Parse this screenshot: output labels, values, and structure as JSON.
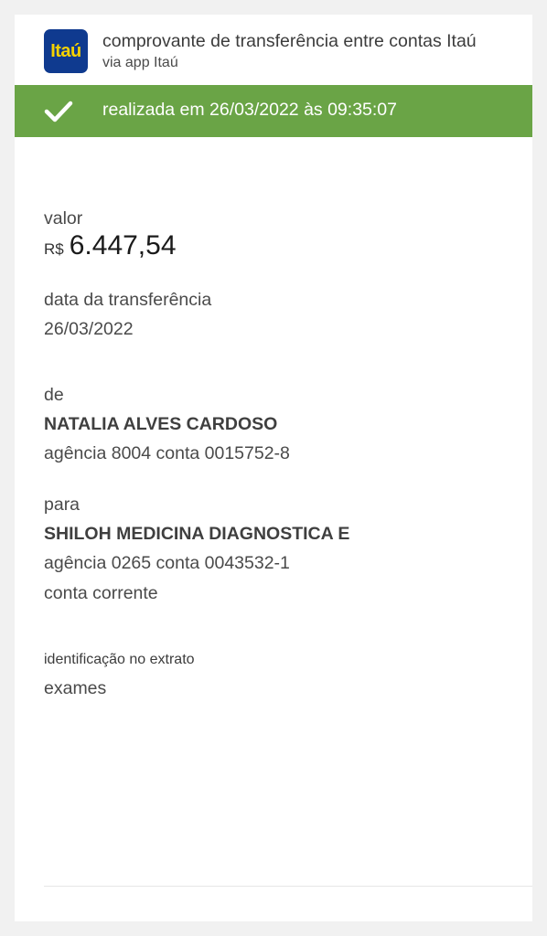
{
  "header": {
    "logo_text": "Itaú",
    "title": "comprovante de transferência entre contas Itaú",
    "subtitle": "via app Itaú"
  },
  "banner": {
    "icon": "check-icon",
    "text": "realizada em 26/03/2022 às 09:35:07",
    "color": "#6aa446"
  },
  "valor": {
    "label": "valor",
    "currency": "R$",
    "amount": "6.447,54"
  },
  "data_transferencia": {
    "label": "data da transferência",
    "value": "26/03/2022"
  },
  "de": {
    "label": "de",
    "name": "NATALIA ALVES CARDOSO",
    "account": "agência 8004 conta 0015752-8"
  },
  "para": {
    "label": "para",
    "name": "SHILOH MEDICINA DIAGNOSTICA E",
    "account": "agência 0265 conta 0043532-1",
    "account_type": "conta corrente"
  },
  "identificacao": {
    "label": "identificação no extrato",
    "value": "exames"
  }
}
